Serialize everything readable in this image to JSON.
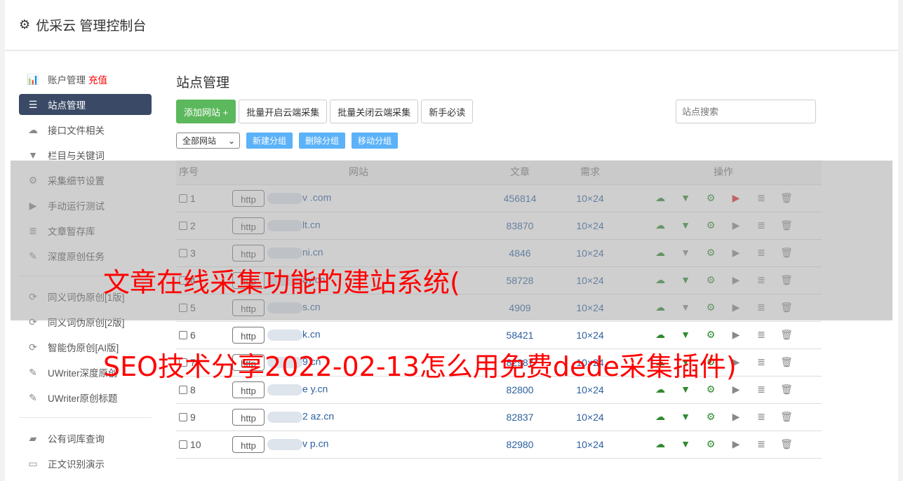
{
  "header": {
    "title": "优采云 管理控制台",
    "icon": "gear-icon"
  },
  "sidebar": {
    "items": [
      {
        "label": "账户管理",
        "extra": "充值",
        "icon": "bar-chart-icon"
      },
      {
        "label": "站点管理",
        "icon": "server-icon",
        "active": true
      },
      {
        "label": "接口文件相关",
        "icon": "cloud-upload-icon"
      },
      {
        "label": "栏目与关键词",
        "icon": "filter-icon"
      },
      {
        "label": "采集细节设置",
        "icon": "gears-icon"
      },
      {
        "label": "手动运行测试",
        "icon": "play-icon"
      },
      {
        "label": "文章暂存库",
        "icon": "database-icon"
      },
      {
        "label": "深度原创任务",
        "icon": "edit-icon"
      },
      {
        "label": "同义词伪原创[1版]",
        "icon": "refresh-icon"
      },
      {
        "label": "同义词伪原创[2版]",
        "icon": "refresh-icon"
      },
      {
        "label": "智能伪原创[AI版]",
        "icon": "refresh-icon"
      },
      {
        "label": "UWriter深度原创",
        "icon": "edit-icon"
      },
      {
        "label": "UWriter原创标题",
        "icon": "edit-icon"
      },
      {
        "label": "公有词库查询",
        "icon": "book-icon"
      },
      {
        "label": "正文识别演示",
        "icon": "monitor-icon"
      }
    ]
  },
  "main": {
    "title": "站点管理",
    "buttons": {
      "add": "添加网站 +",
      "enable": "批量开启云端采集",
      "disable": "批量关闭云端采集",
      "guide": "新手必读"
    },
    "search_placeholder": "站点搜索",
    "group_select": "全部网站",
    "group_buttons": {
      "new": "新建分组",
      "delete": "删除分组",
      "move": "移动分组"
    },
    "table": {
      "headers": [
        "序号",
        "网站",
        "文章",
        "需求",
        "操作"
      ],
      "rows": [
        {
          "n": "1",
          "proto": "http",
          "site": "v .com",
          "articles": "456814",
          "need": "10×24",
          "filter_on": true,
          "play_red": true
        },
        {
          "n": "2",
          "proto": "http",
          "site": "lt.cn",
          "articles": "83870",
          "need": "10×24",
          "filter_on": true
        },
        {
          "n": "3",
          "proto": "http",
          "site": "ni.cn",
          "articles": "4846",
          "need": "10×24",
          "filter_on": false
        },
        {
          "n": "4",
          "proto": "http",
          "site": "ay.cn",
          "articles": "58728",
          "need": "10×24",
          "filter_on": true
        },
        {
          "n": "5",
          "proto": "http",
          "site": "s.cn",
          "articles": "4909",
          "need": "10×24",
          "filter_on": false
        },
        {
          "n": "6",
          "proto": "http",
          "site": "k.cn",
          "articles": "58421",
          "need": "10×24",
          "filter_on": true
        },
        {
          "n": "7",
          "proto": "http",
          "site": "9.cn",
          "articles": "82987",
          "need": "10×24",
          "filter_on": true
        },
        {
          "n": "8",
          "proto": "http",
          "site": "e y.cn",
          "articles": "82800",
          "need": "10×24",
          "filter_on": true
        },
        {
          "n": "9",
          "proto": "http",
          "site": "2 az.cn",
          "articles": "82837",
          "need": "10×24",
          "filter_on": true
        },
        {
          "n": "10",
          "proto": "http",
          "site": "v p.cn",
          "articles": "82980",
          "need": "10×24",
          "filter_on": true
        }
      ]
    }
  },
  "overlay": {
    "line1": "文章在线采集功能的建站系统(",
    "line2": "SEO技术分享2022-02-13怎么用免费dede采集插件)"
  },
  "colors": {
    "accent_green": "#5cb85c",
    "sidebar_active": "#3a4a66",
    "overlay_text": "#ff0000",
    "group_button": "#5bb2f8"
  }
}
